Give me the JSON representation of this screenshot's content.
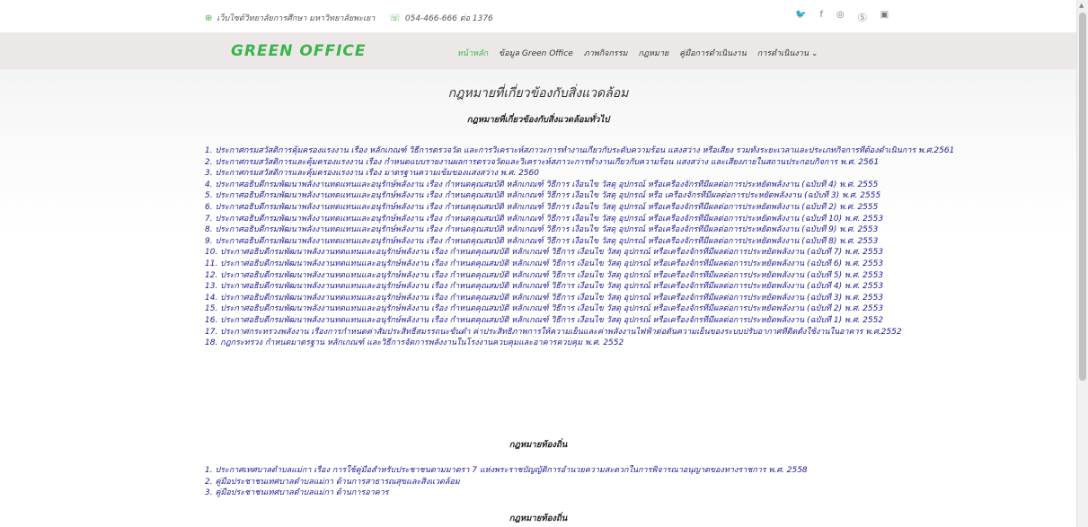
{
  "topbar": {
    "site_text": "เว็บไซต์วิทยาลัยการศึกษา มหาวิทยาลัยพะเยา",
    "phone_text": "054-466-666 ต่อ 1376",
    "social_icons": [
      "twitter-icon",
      "facebook-icon",
      "instagram-icon",
      "skype-icon",
      "linkedin-icon"
    ]
  },
  "navbar": {
    "logo": "GREEN OFFICE",
    "menu": [
      "หน้าหลัก",
      "ข้อมูล Green Office",
      "ภาพกิจกรรม",
      "กฎหมาย",
      "คู่มือการดำเนินงาน",
      "การดำเนินงาน ⌄"
    ]
  },
  "main": {
    "page_title": "กฎหมายที่เกี่ยวข้องกับสิ่งแวดล้อม",
    "section1_title": "กฎหมายที่เกี่ยวข้องกับสิ่งแวดล้อมทั่วไป",
    "section1_items": [
      "1. ประกาศกรมสวัสดิการคุ้มครองแรงงาน เรื่อง หลักเกณฑ์ วิธีการตรวจวัด และการวิเคราะห์สภาวะการทำงานเกี่ยวกับระดับความร้อน แสงสว่าง หรือเสียง รวมทั้งระยะเวลาและประเภทกิจการที่ต้องดำเนินการ พ.ศ.2561",
      "2. ประกาศกรมสวัสดิการและคุ้มครองแรงงาน เรื่อง กำหนดแบบรายงานผลการตรวจวัดและวิเคราะห์สภาวะการทำงานเกี่ยวกับความร้อน แสงสว่าง และเสียงภายในสถานประกอบกิจการ พ.ศ. 2561",
      "3. ประกาศกรมสวัสดิการและคุ้มครองแรงงาน เรื่อง มาตรฐานความเข้มของแสงสว่าง พ.ศ. 2560",
      "4. ประกาศอธิบดีกรมพัฒนาพลังงานทดแทนและอนุรักษ์พลังงาน เรื่อง กำหนดคุณสมบัติ หลักเกณฑ์ วิธีการ เงื่อนไข วัสดุ อุปกรณ์ หรือเครื่องจักรที่มีผลต่อการประหยัดพลังงาน (ฉบับที่ 4) พ.ศ. 2555",
      "5. ประกาศอธิบดีกรมพัฒนาพลังงานทดแทนและอนุรักษ์พลังงาน เรื่อง กำหนดคุณสมบัติ หลักเกณฑ์ วิธีการ เงื่อนไข วัสดุ อุปกรณ์ หรือ เครื่องจักรที่มีผลต่อการประหยัดพลังงาน (ฉบับที่ 3) พ.ศ. 2555",
      "6. ประกาศอธิบดีกรมพัฒนาพลังงานทดแทนและอนุรักษ์พลังงาน เรื่อง กำหนดคุณสมบัติ หลักเกณฑ์ วิธีการ เงื่อนไข วัสดุ อุปกรณ์ หรือเครื่องจักรที่มีผลต่อการประหยัดพลังงาน (ฉบับที่ 2) พ.ศ. 2555",
      "7. ประกาศอธิบดีกรมพัฒนาพลังงานทดแทนและอนุรักษ์พลังงาน เรื่อง กำหนดคุณสมบัติ หลักเกณฑ์ วิธีการ เงื่อนไข วัสดุ อุปกรณ์ หรือเครื่องจักรที่มีผลต่อการประหยัดพลังงาน (ฉบับที่ 10) พ.ศ. 2553",
      "8. ประกาศอธิบดีกรมพัฒนาพลังงานทดแทนและอนุรักษ์พลังงาน เรื่อง กำหนดคุณสมบัติ หลักเกณฑ์ วิธีการ เงื่อนไข วัสดุ อุปกรณ์ หรือเครื่องจักรที่มีผลต่อการประหยัดพลังงาน (ฉบับที่ 9) พ.ศ. 2553",
      "9. ประกาศอธิบดีกรมพัฒนาพลังงานทดแทนและอนุรักษ์พลังงาน เรื่อง กำหนดคุณสมบัติ หลักเกณฑ์ วิธีการ เงื่อนไข วัสดุ อุปกรณ์ หรือเครื่องจักรที่มีผลต่อการประหยัดพลังงาน (ฉบับที่ 8) พ.ศ. 2553",
      "10. ประกาศอธิบดีกรมพัฒนาพลังงานทดแทนและอนุรักษ์พลังงาน เรื่อง กำหนดคุณสมบัติ หลักเกณฑ์ วิธีการ เงื่อนไข วัสดุ อุปกรณ์ หรือเครื่องจักรที่มีผลต่อการประหยัดพลังงาน (ฉบับที่ 7) พ.ศ. 2553",
      "11. ประกาศอธิบดีกรมพัฒนาพลังงานทดแทนและอนุรักษ์พลังงาน เรื่อง กำหนดคุณสมบัติ หลักเกณฑ์ วิธีการ เงื่อนไข วัสดุ อุปกรณ์ หรือเครื่องจักรที่มีผลต่อการประหยัดพลังงาน (ฉบับที่ 6) พ.ศ. 2553",
      "12. ประกาศอธิบดีกรมพัฒนาพลังงานทดแทนและอนุรักษ์พลังงาน เรื่อง กำหนดคุณสมบัติ หลักเกณฑ์ วิธีการ เงื่อนไข วัสดุ อุปกรณ์ หรือเครื่องจักรที่มีผลต่อการประหยัดพลังงาน (ฉบับที่ 5) พ.ศ. 2553",
      "13. ประกาศอธิบดีกรมพัฒนาพลังงานทดแทนและอนุรักษ์พลังงาน เรื่อง กำหนดคุณสมบัติ หลักเกณฑ์ วิธีการ เงื่อนไข วัสดุ อุปกรณ์ หรือเครื่องจักรที่มีผลต่อการประหยัดพลังงาน (ฉบับที่ 4) พ.ศ. 2553",
      "14. ประกาศอธิบดีกรมพัฒนาพลังงานทดแทนและอนุรักษ์พลังงาน เรื่อง กำหนดคุณสมบัติ หลักเกณฑ์ วิธีการ เงื่อนไข วัสดุ อุปกรณ์ หรือเครื่องจักรที่มีผลต่อการประหยัดพลังงาน (ฉบับที่ 3) พ.ศ. 2553",
      "15. ประกาศอธิบดีกรมพัฒนาพลังงานทดแทนและอนุรักษ์พลังงาน เรื่อง กำหนดคุณสมบัติ หลักเกณฑ์ วิธีการ เงื่อนไข วัสดุ อุปกรณ์ หรือเครื่องจักรที่มีผลต่อการประหยัดพลังงาน (ฉบับที่ 2) พ.ศ. 2553",
      "16. ประกาศอธิบดีกรมพัฒนาพลังงานทดแทนและอนุรักษ์พลังงาน เรื่อง กำหนดคุณสมบัติ หลักเกณฑ์ วิธีการ เงื่อนไข วัสดุ อุปกรณ์ หรือเครื่องจักรที่มีผลต่อการประหยัดพลังงาน (ฉบับที่ 1) พ.ศ. 2552",
      "17. ประกาศกระทรวงพลังงาน เรื่องการกำหนดค่าสัมประสิทธิ์สมรรถนะขั้นต่ำ ค่าประสิทธิภาพการให้ความเย็นและค่าพลังงานไฟฟ้าต่อตันความเย็นของระบบปรับอากาศที่ติดตั้งใช้งานในอาคาร พ.ศ.2552",
      "18. กฎกระทรวง กำหนดมาตรฐาน หลักเกณฑ์ และวิธีการจัดการพลังงานในโรงงานควบคุมและอาคารควบคุม พ.ศ. 2552"
    ],
    "section2_title": "กฎหมายท้องถิ่น",
    "section2_items": [
      "1. ประกาศเทศบาลตำบลแม่กา เรื่อง การใช้คู่มือสำหรับประชาชนตามมาตรา 7 แห่งพระราชบัญญัติการอำนวยความสะดวกในการพิจารณาอนุญาตของทางราชการ พ.ศ. 2558",
      "2. คู่มือประชาชนเทศบาลตำบลแม่กา ด้านการสาธารณสุขและสิ่งแวดล้อม",
      "3. คู่มือประชาชนเทศบาลตำบลแม่กา ด้านการอาคาร"
    ],
    "section3_title": "กฎหมายท้องถิ่น"
  }
}
